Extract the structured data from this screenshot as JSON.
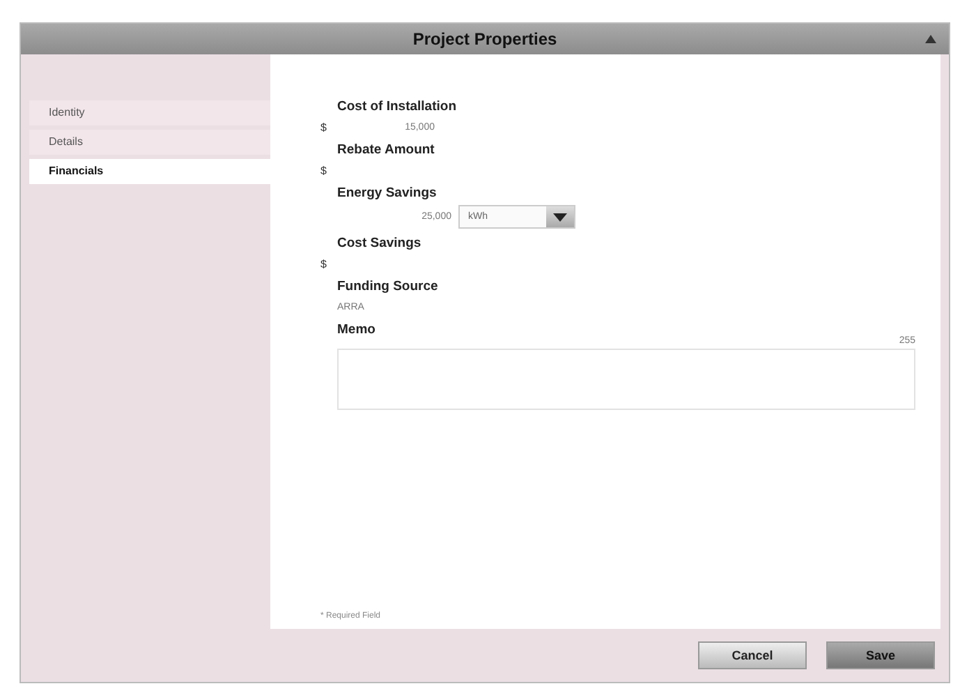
{
  "window": {
    "title": "Project Properties"
  },
  "sidebar": {
    "items": [
      {
        "label": "Identity",
        "selected": false
      },
      {
        "label": "Details",
        "selected": false
      },
      {
        "label": "Financials",
        "selected": true
      }
    ]
  },
  "fields": [
    {
      "kind": "money",
      "label": "Cost of Installation",
      "prefix": "$",
      "value": "15,000"
    },
    {
      "kind": "money",
      "label": "Rebate Amount",
      "prefix": "$"
    },
    {
      "kind": "measure",
      "label": "Energy Savings",
      "value": "25,000",
      "unit": "kWh"
    },
    {
      "kind": "money",
      "label": "Cost Savings",
      "prefix": "$"
    },
    {
      "kind": "text",
      "label": "Funding Source",
      "value": "ARRA"
    },
    {
      "kind": "memo",
      "label": "Memo",
      "counter": "255"
    }
  ],
  "footnote": "* Required Field",
  "buttons": [
    {
      "label": "Cancel",
      "kind": "secondary"
    },
    {
      "label": "Save",
      "kind": "primary"
    }
  ]
}
